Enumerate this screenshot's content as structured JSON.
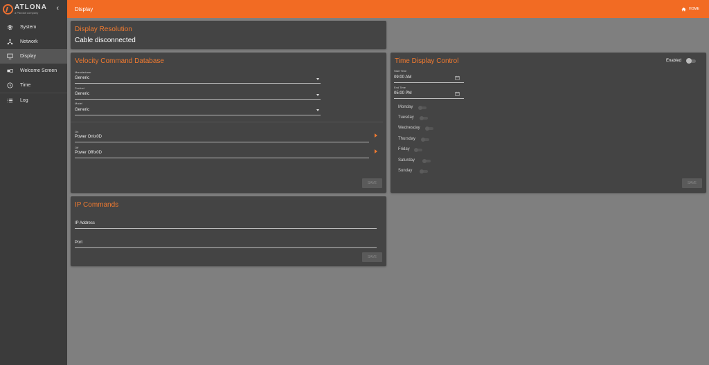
{
  "brand": {
    "logo_word": "ATLONA",
    "logo_sub": "a Panduit company",
    "collapse": "‹"
  },
  "header": {
    "title": "Display",
    "home": "HOME"
  },
  "sidebar": {
    "items": [
      {
        "label": "System",
        "icon": "gear-icon",
        "active": false
      },
      {
        "label": "Network",
        "icon": "network-icon",
        "active": false
      },
      {
        "label": "Display",
        "icon": "monitor-icon",
        "active": true
      },
      {
        "label": "Welcome Screen",
        "icon": "welcome-screen-icon",
        "active": false
      },
      {
        "label": "Time",
        "icon": "clock-icon",
        "active": false
      },
      {
        "label": "Log",
        "icon": "list-icon",
        "active": false
      }
    ]
  },
  "display_resolution": {
    "title": "Display Resolution",
    "status": "Cable disconnected"
  },
  "velocity": {
    "title": "Velocity Command Database",
    "manufacturer_label": "Manufacturer",
    "manufacturer_value": "Generic",
    "product_label": "Product",
    "product_value": "Generic",
    "model_label": "Model",
    "model_value": "Generic",
    "on_label": "On",
    "on_value": "Power On\\x0D",
    "off_label": "Off",
    "off_value": "Power Off\\x0D",
    "save": "SAVE"
  },
  "time_display": {
    "title": "Time Display Control",
    "enabled_label": "Enabled",
    "enabled": false,
    "start_label": "Start Time",
    "start_value": "09:00 AM",
    "end_label": "End Time",
    "end_value": "05:00 PM",
    "days": [
      "Monday",
      "Tuesday",
      "Wednesday",
      "Thursday",
      "Friday",
      "Saturday",
      "Sunday"
    ],
    "save": "SAVE"
  },
  "ip_commands": {
    "title": "IP Commands",
    "ip_label": "IP Address",
    "port_label": "Port",
    "save": "SAVE"
  },
  "colors": {
    "accent": "#f26b23",
    "sidebar": "#3b3b3b",
    "card": "#444444",
    "background": "#7f7f7f"
  }
}
